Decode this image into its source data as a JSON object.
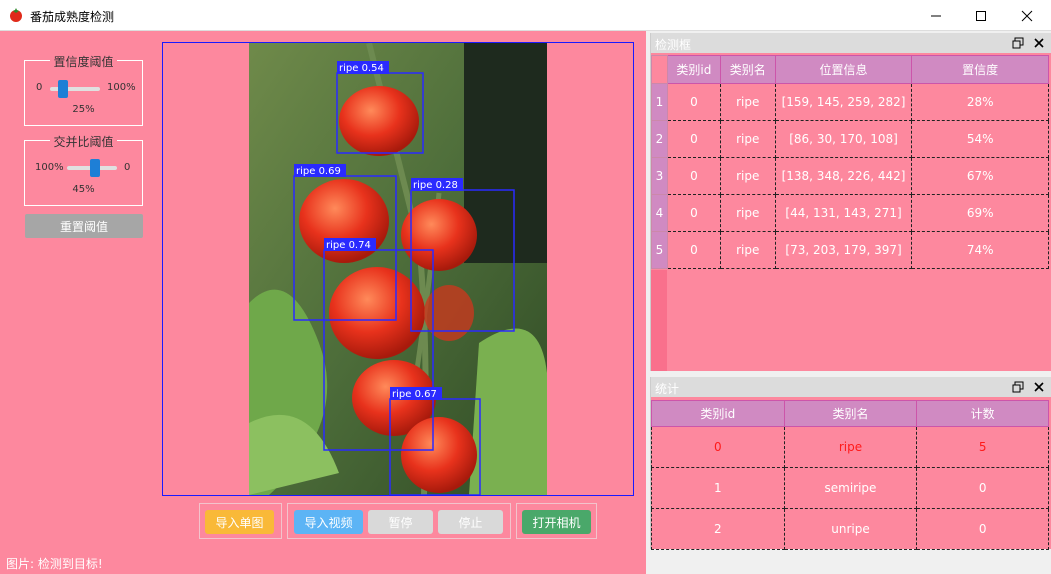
{
  "window": {
    "title": "番茄成熟度检测",
    "icon": "tomato-icon"
  },
  "confidence": {
    "title": "置信度阈值",
    "min_label": "0",
    "max_label": "100%",
    "value": 25,
    "value_label": "25%"
  },
  "iou": {
    "title": "交并比阈值",
    "min_label": "100%",
    "max_label": "0",
    "value": 45,
    "value_label": "45%"
  },
  "reset_label": "重置阈值",
  "buttons": {
    "import_image": "导入单图",
    "import_video": "导入视频",
    "pause": "暂停",
    "stop": "停止",
    "open_camera": "打开相机"
  },
  "colors": {
    "import_image": "#f9b938",
    "import_video": "#5cb4f5",
    "pause": "#d9d9d9",
    "stop": "#d9d9d9",
    "open_camera": "#4aa86a"
  },
  "status": "图片: 检测到目标!",
  "detections": [
    {
      "label": "ripe 0.54"
    },
    {
      "label": "ripe 0.69"
    },
    {
      "label": "ripe 0.28"
    },
    {
      "label": "ripe 0.74"
    },
    {
      "label": "ripe 0.67"
    }
  ],
  "detect_panel": {
    "title": "检测框",
    "headers": [
      "类别id",
      "类别名",
      "位置信息",
      "置信度"
    ],
    "rows": [
      {
        "num": "1",
        "id": "0",
        "name": "ripe",
        "pos": "[159, 145, 259, 282]",
        "conf": "28%"
      },
      {
        "num": "2",
        "id": "0",
        "name": "ripe",
        "pos": "[86, 30, 170, 108]",
        "conf": "54%"
      },
      {
        "num": "3",
        "id": "0",
        "name": "ripe",
        "pos": "[138, 348, 226, 442]",
        "conf": "67%"
      },
      {
        "num": "4",
        "id": "0",
        "name": "ripe",
        "pos": "[44, 131, 143, 271]",
        "conf": "69%"
      },
      {
        "num": "5",
        "id": "0",
        "name": "ripe",
        "pos": "[73, 203, 179, 397]",
        "conf": "74%"
      }
    ]
  },
  "stats_panel": {
    "title": "统计",
    "headers": [
      "类别id",
      "类别名",
      "计数"
    ],
    "rows": [
      {
        "id": "0",
        "name": "ripe",
        "count": "5"
      },
      {
        "id": "1",
        "name": "semiripe",
        "count": "0"
      },
      {
        "id": "2",
        "name": "unripe",
        "count": "0"
      }
    ]
  }
}
